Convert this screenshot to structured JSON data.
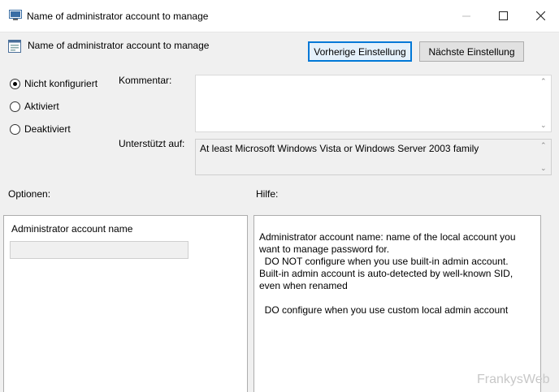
{
  "window": {
    "title": "Name of administrator account to manage",
    "minimize_icon": "minimize-icon",
    "maximize_icon": "maximize-icon",
    "close_icon": "close-icon"
  },
  "header": {
    "title": "Name of administrator account to manage",
    "icon": "policy-settings-icon"
  },
  "nav": {
    "prev_label": "Vorherige Einstellung",
    "next_label": "Nächste Einstellung"
  },
  "state": {
    "options": [
      {
        "label": "Nicht konfiguriert",
        "checked": true
      },
      {
        "label": "Aktiviert",
        "checked": false
      },
      {
        "label": "Deaktiviert",
        "checked": false
      }
    ]
  },
  "comment": {
    "label": "Kommentar:",
    "value": ""
  },
  "supported": {
    "label": "Unterstützt auf:",
    "value": "At least Microsoft Windows Vista or Windows Server 2003 family"
  },
  "options": {
    "label": "Optionen:",
    "field_label": "Administrator account name",
    "field_value": ""
  },
  "help": {
    "label": "Hilfe:",
    "text": "Administrator account name: name of the local account you want to manage password for.\n  DO NOT configure when you use built-in admin account. Built-in admin account is auto-detected by well-known SID, even when renamed\n\n  DO configure when you use custom local admin account"
  },
  "watermark": "FrankysWeb"
}
